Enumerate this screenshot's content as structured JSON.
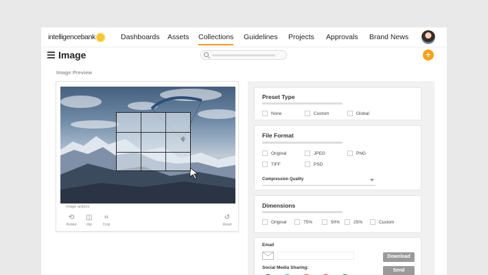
{
  "brand": {
    "logo_text": "intelligencebank"
  },
  "nav": {
    "items": [
      {
        "label": "Dashboards"
      },
      {
        "label": "Assets"
      },
      {
        "label": "Collections"
      },
      {
        "label": "Guidelines"
      },
      {
        "label": "Projects"
      },
      {
        "label": "Approvals"
      },
      {
        "label": "Brand News"
      }
    ],
    "active": "Collections"
  },
  "page": {
    "title": "Image",
    "add_label": "+"
  },
  "preview": {
    "section_label": "Image Preview",
    "actions_label": "Image actions",
    "actions": [
      {
        "label": "Rotate",
        "icon": "rotate-icon"
      },
      {
        "label": "Flip",
        "icon": "flip-icon"
      },
      {
        "label": "Crop",
        "icon": "crop-icon"
      }
    ],
    "reset_label": "Reset"
  },
  "preset": {
    "title": "Preset Type",
    "options": [
      "None",
      "Custom",
      "Global"
    ]
  },
  "format": {
    "title": "File Format",
    "options": [
      "Original",
      "JPEG",
      "PNG",
      "TIFF",
      "PSD"
    ],
    "compression_label": "Compression Quality"
  },
  "dimensions": {
    "title": "Dimensions",
    "options": [
      "Original",
      "75%",
      "50%",
      "25%",
      "Custom"
    ]
  },
  "share": {
    "email_label": "Email",
    "social_label": "Social Media Sharing:",
    "download_label": "Download",
    "send_label": "Send",
    "social_colors": [
      "#2f5aa8",
      "#1da1f2",
      "#dd4b39",
      "#e03a3a",
      "#0e76a8"
    ]
  },
  "colors": {
    "accent": "#f39a1e",
    "button_gray": "#9a9a9a"
  }
}
